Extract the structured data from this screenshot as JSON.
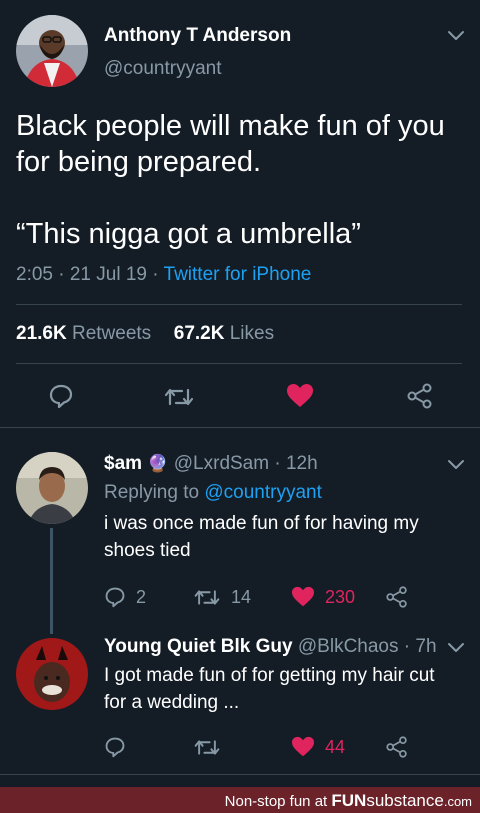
{
  "tweet": {
    "author_name": "Anthony T Anderson",
    "author_handle": "@countryyant",
    "text_line1": "Black people will make fun of you",
    "text_line2": "for being prepared.",
    "text_line3": "“This nigga got a umbrella”",
    "time": "2:05 · 21 Jul 19 · ",
    "source": "Twitter for iPhone",
    "retweets_count": "21.6K",
    "retweets_label": "Retweets",
    "likes_count": "67.2K",
    "likes_label": "Likes"
  },
  "reply1": {
    "name": "$am",
    "emoji": "🔮",
    "handle_time": "@LxrdSam · 12h",
    "replying_prefix": "Replying to ",
    "replying_handle": "@countryyant",
    "text_line1": "i was once made fun of for having my",
    "text_line2": "shoes tied",
    "reply_count": "2",
    "retweet_count": "14",
    "like_count": "230"
  },
  "reply2": {
    "name": "Young Quiet Blk Guy",
    "handle_time": "@BlkChaos · 7h",
    "text_line1": "I got made fun of for getting my hair cut",
    "text_line2": "for a wedding ...",
    "like_count": "44"
  },
  "footer": {
    "tagline": "Non-stop fun at ",
    "brand_fun": "FUN",
    "brand_sub": "substance",
    "brand_com": ".com"
  },
  "colors": {
    "background": "#141d26",
    "muted": "#8899a6",
    "link": "#1da1f2",
    "like": "#e0245e",
    "footer": "#6b2229"
  }
}
